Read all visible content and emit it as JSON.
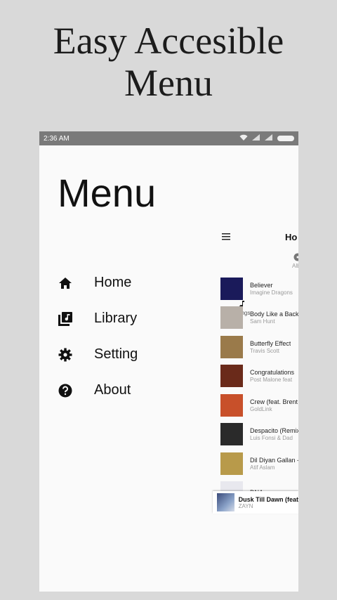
{
  "headline": {
    "line1": "Easy Accesible",
    "line2": "Menu"
  },
  "status_bar": {
    "time": "2:36 AM"
  },
  "drawer": {
    "title": "Menu",
    "items": [
      {
        "label": "Home",
        "icon": "home-icon"
      },
      {
        "label": "Library",
        "icon": "library-icon"
      },
      {
        "label": "Setting",
        "icon": "gear-icon"
      },
      {
        "label": "About",
        "icon": "help-icon"
      }
    ]
  },
  "preview": {
    "title": "Ho",
    "tabs": [
      {
        "label": "Songs",
        "icon": "music-note-icon"
      },
      {
        "label": "Albu",
        "icon": "album-icon"
      }
    ],
    "songs": [
      {
        "name": "Believer",
        "artist": "Imagine Dragons",
        "art_color": "#1a1a5a"
      },
      {
        "name": "Body Like a Back",
        "artist": "Sam Hunt",
        "art_color": "#b8b0a8"
      },
      {
        "name": "Butterfly Effect",
        "artist": "Travis Scott",
        "art_color": "#9a7a4a"
      },
      {
        "name": "Congratulations",
        "artist": "Post Malone feat",
        "art_color": "#6a2a1a"
      },
      {
        "name": "Crew (feat. Brent",
        "artist": "GoldLink",
        "art_color": "#c8502a"
      },
      {
        "name": "Despacito (Remix",
        "artist": "Luis Fonsi & Dad",
        "art_color": "#2a2a2a"
      },
      {
        "name": "Dil Diyan Gallan -",
        "artist": "Atif Aslam",
        "art_color": "#b89a4a"
      },
      {
        "name": "DNA",
        "artist": "",
        "art_color": "#e8e8ee"
      }
    ],
    "now_playing": {
      "name": "Dusk Till Dawn (feat",
      "artist": "ZAYN"
    }
  }
}
